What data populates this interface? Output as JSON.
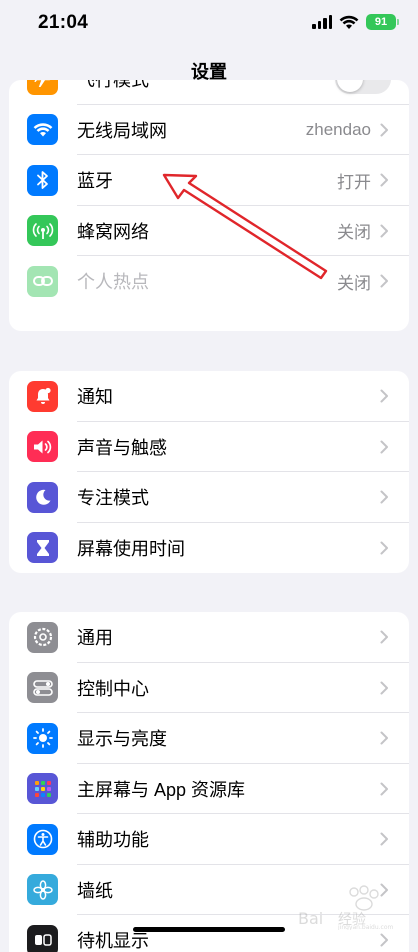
{
  "status_bar": {
    "time": "21:04",
    "battery": "91"
  },
  "nav": {
    "title": "设置"
  },
  "group1": [
    {
      "label": "飞行模式",
      "icon": "airplane-icon",
      "color": "#ff9500",
      "type": "toggle",
      "on": false
    },
    {
      "label": "无线局域网",
      "icon": "wifi-icon",
      "color": "#007aff",
      "value": "zhendao"
    },
    {
      "label": "蓝牙",
      "icon": "bluetooth-icon",
      "color": "#007aff",
      "value": "打开"
    },
    {
      "label": "蜂窝网络",
      "icon": "cellular-icon",
      "color": "#34c759",
      "value": "关闭"
    },
    {
      "label": "个人热点",
      "icon": "hotspot-icon",
      "color": "#34c759",
      "value": "关闭",
      "disabled": true
    }
  ],
  "group2": [
    {
      "label": "通知",
      "icon": "bell-icon",
      "color": "#ff3b30"
    },
    {
      "label": "声音与触感",
      "icon": "speaker-icon",
      "color": "#ff2d55"
    },
    {
      "label": "专注模式",
      "icon": "moon-icon",
      "color": "#5856d6"
    },
    {
      "label": "屏幕使用时间",
      "icon": "hourglass-icon",
      "color": "#5856d6"
    }
  ],
  "group3": [
    {
      "label": "通用",
      "icon": "gear-icon",
      "color": "#8e8e93"
    },
    {
      "label": "控制中心",
      "icon": "switches-icon",
      "color": "#8e8e93"
    },
    {
      "label": "显示与亮度",
      "icon": "sun-icon",
      "color": "#007aff"
    },
    {
      "label": "主屏幕与 App 资源库",
      "icon": "app-grid-icon",
      "color": "#5856d6"
    },
    {
      "label": "辅助功能",
      "icon": "accessibility-icon",
      "color": "#007aff"
    },
    {
      "label": "墙纸",
      "icon": "flower-icon",
      "color": "#35aadc"
    },
    {
      "label": "待机显示",
      "icon": "standby-icon",
      "color": "#1c1c1e"
    }
  ],
  "annotation_arrow": {
    "color": "#e0262b"
  }
}
